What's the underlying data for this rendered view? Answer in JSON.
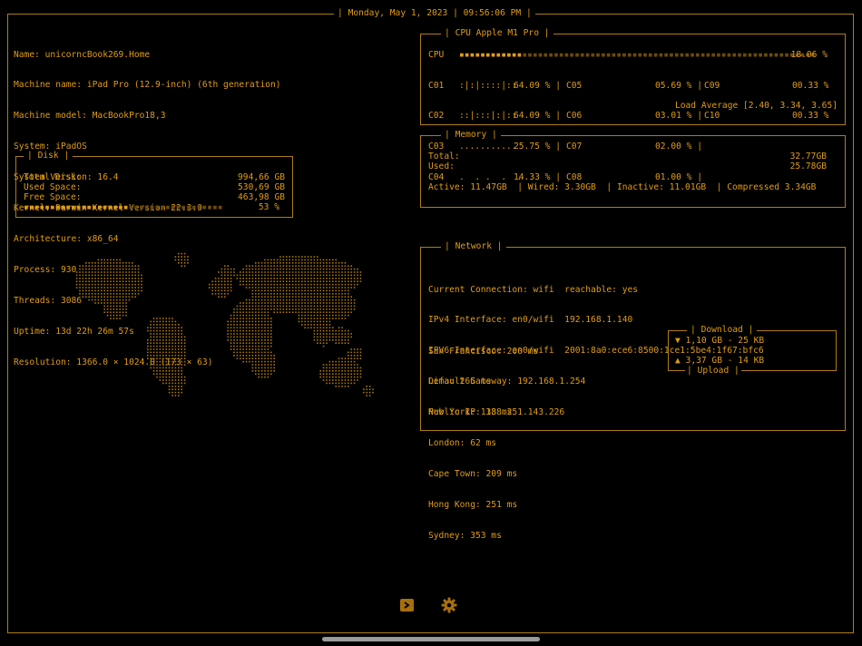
{
  "header": {
    "datetime": "Monday, May 1, 2023 | 09:56:06 PM"
  },
  "system_info": [
    "Name: unicorncBook269.Home",
    "Machine name: iPad Pro (12.9-inch) (6th generation)",
    "Machine model: MacBookPro18,3",
    "System: iPadOS",
    "System Version: 16.4",
    "Kernel: Darwin Kernel Version 22.3.0",
    "Architecture: x86_64",
    "Process: 930",
    "Threads: 3086",
    "Uptime: 13d 22h 26m 57s",
    "Resolution: 1366.0 × 1024.0 (173 × 63)"
  ],
  "disk": {
    "title": "Disk",
    "total_label": "Total Disk:",
    "total_value": "994,66 GB",
    "used_label": "Used Space:",
    "used_value": "530,69 GB",
    "free_label": "Free Space:",
    "free_value": "463,98 GB",
    "usage_percent": 53,
    "usage_text": "53 %"
  },
  "cpu": {
    "title": "CPU Apple M1 Pro",
    "label": "CPU",
    "total_percent": 18.06,
    "total_text": "18.06 %",
    "cores_col1": [
      {
        "name": "C01",
        "spark": ":|:|::::|::",
        "value": "64.09 %"
      },
      {
        "name": "C02",
        "spark": "::|:::|:|::",
        "value": "64.09 %"
      },
      {
        "name": "C03",
        "spark": "...........",
        "value": "25.75 %"
      },
      {
        "name": "C04",
        "spark": ".  . .  .  .",
        "value": "14.33 %"
      }
    ],
    "cores_col2": [
      {
        "name": "C05",
        "value": "05.69 %"
      },
      {
        "name": "C06",
        "value": "03.01 %"
      },
      {
        "name": "C07",
        "value": "02.00 %"
      },
      {
        "name": "C08",
        "value": "01.00 %"
      }
    ],
    "cores_col3": [
      {
        "name": "C09",
        "value": "00.33 %"
      },
      {
        "name": "C10",
        "value": "00.33 %"
      }
    ],
    "load_average": "Load Average [2.40, 3.34, 3.65]"
  },
  "memory": {
    "title": "Memory",
    "total_label": "Total:",
    "total_value": "32.77GB",
    "used_label": "Used:",
    "used_value": "25.78GB",
    "active": "Active: 11.47GB",
    "wired": "Wired: 3.30GB",
    "inactive": "Inactive: 11.01GB",
    "compressed": "Compressed 3.34GB"
  },
  "network": {
    "title": "Network",
    "current_connection": "Current Connection: wifi  reachable: yes",
    "ipv4": "IPv4 Interface: en0/wifi  192.168.1.140",
    "ipv6": "IPV6 Interface: en0/wifi  2001:8a0:ece6:8500:1ce1:5be4:1f67:bfc6",
    "gateway": "Default Gateway: 192.168.1.254",
    "public_ip": "Public IP: 188.251.143.226",
    "pings": [
      "San Francisco: 200 ms",
      "Lima: 265 ms",
      "New York: 133 ms",
      "London: 62 ms",
      "Cape Town: 209 ms",
      "Hong Kong: 251 ms",
      "Sydney: 353 ms"
    ],
    "download_title": "Download",
    "download_value": "▼ 1,10 GB - 25 KB",
    "upload_title": "Upload",
    "upload_value": "▲ 3,37 GB - 14 KB"
  },
  "toolbar": {
    "terminal_icon": "terminal-icon",
    "settings_icon": "gear-icon"
  },
  "colors": {
    "accent": "#e09c18",
    "border": "#b07c14",
    "dim": "#6b4a0c",
    "background": "#000000"
  }
}
